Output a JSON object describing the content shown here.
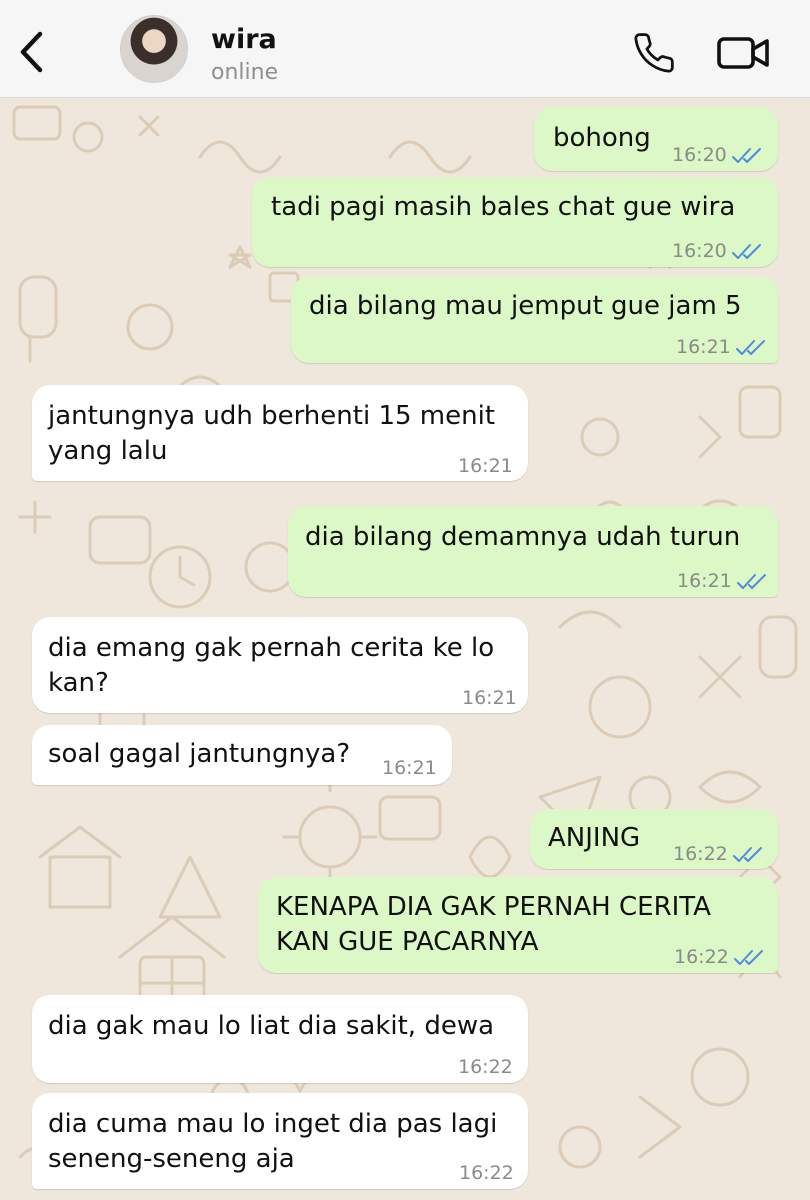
{
  "header": {
    "name": "wira",
    "status": "online"
  },
  "messages": [
    {
      "id": "m1",
      "dir": "out",
      "text": "bohong",
      "time": "16:20",
      "read": true
    },
    {
      "id": "m2",
      "dir": "out",
      "text": "tadi pagi masih bales chat gue wira",
      "time": "16:20",
      "read": true
    },
    {
      "id": "m3",
      "dir": "out",
      "text": "dia bilang mau jemput gue jam 5",
      "time": "16:21",
      "read": true
    },
    {
      "id": "m4",
      "dir": "in",
      "text": "jantungnya udh berhenti 15 menit\nyang lalu",
      "time": "16:21"
    },
    {
      "id": "m5",
      "dir": "out",
      "text": "dia bilang demamnya udah turun",
      "time": "16:21",
      "read": true
    },
    {
      "id": "m6",
      "dir": "in",
      "text": "dia emang gak pernah cerita ke lo\nkan?",
      "time": "16:21"
    },
    {
      "id": "m7",
      "dir": "in",
      "text": "soal gagal jantungnya?",
      "time": "16:21"
    },
    {
      "id": "m8",
      "dir": "out",
      "text": "ANJING",
      "time": "16:22",
      "read": true
    },
    {
      "id": "m9",
      "dir": "out",
      "text": "KENAPA DIA GAK PERNAH CERITA\nKAN GUE PACARNYA",
      "time": "16:22",
      "read": true
    },
    {
      "id": "m10",
      "dir": "in",
      "text": "dia gak mau lo liat dia sakit, dewa",
      "time": "16:22"
    },
    {
      "id": "m11",
      "dir": "in",
      "text": "dia cuma mau lo inget dia pas lagi\nseneng-seneng aja",
      "time": "16:22"
    }
  ],
  "colors": {
    "outgoing_bubble": "#dcf8c6",
    "incoming_bubble": "#ffffff",
    "read_ticks": "#4f8ae0",
    "wallpaper": "#efe7dc"
  },
  "icons": {
    "back": "chevron-left-icon",
    "call": "phone-icon",
    "video": "video-camera-icon",
    "read": "double-check-icon"
  }
}
